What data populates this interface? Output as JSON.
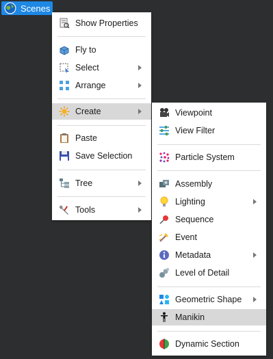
{
  "scenes_button": {
    "label": "Scenes"
  },
  "main_menu": {
    "show_properties": "Show Properties",
    "fly_to": "Fly to",
    "select": "Select",
    "arrange": "Arrange",
    "create": "Create",
    "paste": "Paste",
    "save_selection": "Save Selection",
    "tree": "Tree",
    "tools": "Tools"
  },
  "create_menu": {
    "viewpoint": "Viewpoint",
    "view_filter": "View Filter",
    "particle_system": "Particle System",
    "assembly": "Assembly",
    "lighting": "Lighting",
    "sequence": "Sequence",
    "event": "Event",
    "metadata": "Metadata",
    "level_of_detail": "Level of Detail",
    "geometric_shape": "Geometric Shape",
    "manikin": "Manikin",
    "dynamic_section": "Dynamic Section"
  },
  "colors": {
    "background": "#2c2e2f",
    "accent": "#1e88e5",
    "highlight": "#d8d8d8"
  }
}
